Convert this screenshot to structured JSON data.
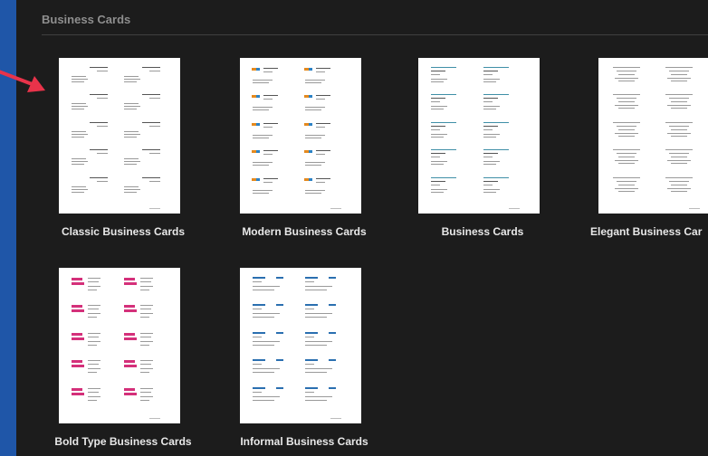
{
  "section": {
    "title": "Business Cards"
  },
  "templates": [
    {
      "label": "Classic Business Cards"
    },
    {
      "label": "Modern Business Cards"
    },
    {
      "label": "Business Cards"
    },
    {
      "label": "Elegant Business Car"
    },
    {
      "label": "Bold Type Business Cards"
    },
    {
      "label": "Informal Business Cards"
    }
  ],
  "colors": {
    "background": "#1f56a8",
    "panel": "#1c1c1c",
    "arrow": "#e8334a"
  }
}
